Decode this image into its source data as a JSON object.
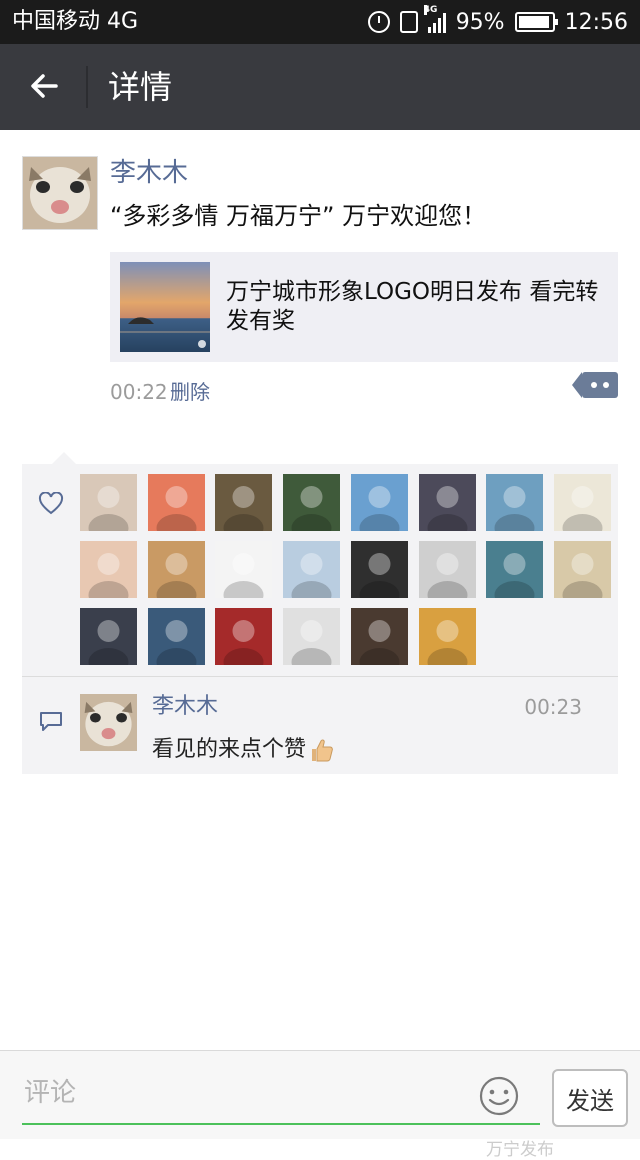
{
  "status_bar": {
    "carrier": "中国移动 4G",
    "network_small": "4G",
    "battery": "95%",
    "battery_level": 0.95,
    "time": "12:56"
  },
  "header": {
    "title": "详情",
    "back_icon": "arrow-left-icon"
  },
  "post": {
    "author": "李木木",
    "text": "“多彩多情 万福万宁” 万宁欢迎您！",
    "link_title": "万宁城市形象LOGO明日发布 看完转发有奖",
    "time": "00:22",
    "delete_label": "删除"
  },
  "likes": {
    "icon": "heart-icon",
    "avatar_colors": [
      [
        "#d9c8b8",
        "#e67a5c",
        "#6a5a40",
        "#3f5a3a",
        "#6aa0d0",
        "#4c4a5a",
        "#6e9fc0",
        "#ece7d8"
      ],
      [
        "#e8c8b2",
        "#c99a64",
        "#f4f4f4",
        "#b9cde0",
        "#2f2f2f",
        "#cfcfcf",
        "#4a7f8f",
        "#d8c9a8"
      ],
      [
        "#3a3f4c",
        "#3a5a7a",
        "#a52a2a",
        "#e0e0e0",
        "#4a3a30",
        "#d9a040"
      ]
    ]
  },
  "comments": [
    {
      "author": "李木木",
      "time": "00:23",
      "text": "看见的来点个赞"
    }
  ],
  "comment_bar": {
    "placeholder": "评论",
    "send_label": "发送",
    "watermark": "万宁发布",
    "accent": "#4cc15b"
  },
  "colors": {
    "link_blue": "#576b95",
    "title_bar": "#393a3f",
    "status_bar": "#1b1b1b"
  }
}
